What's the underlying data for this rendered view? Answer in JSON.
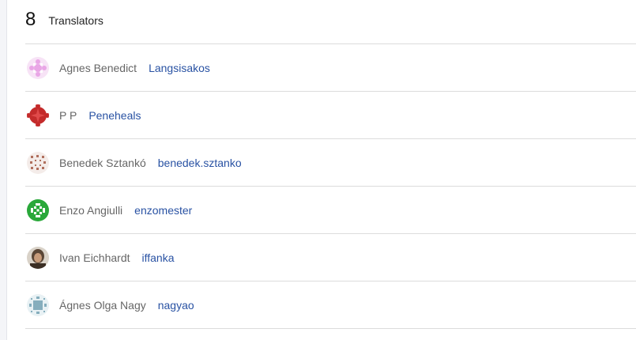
{
  "translators": {
    "count": "8",
    "title": "Translators",
    "items": [
      {
        "name": "Agnes Benedict",
        "username": "Langsisakos",
        "avatar_color": "#e9a6e6"
      },
      {
        "name": "P P",
        "username": "Peneheals",
        "avatar_color": "#c42b2b"
      },
      {
        "name": "Benedek Sztankó",
        "username": "benedek.sztanko",
        "avatar_color": "#b06f5d"
      },
      {
        "name": "Enzo Angiulli",
        "username": "enzomester",
        "avatar_color": "#2aa83a"
      },
      {
        "name": "Ivan Eichhardt",
        "username": "iffanka",
        "avatar_color": "#5a4636"
      },
      {
        "name": "Ágnes Olga Nagy",
        "username": "nagyao",
        "avatar_color": "#86aebd"
      }
    ]
  }
}
